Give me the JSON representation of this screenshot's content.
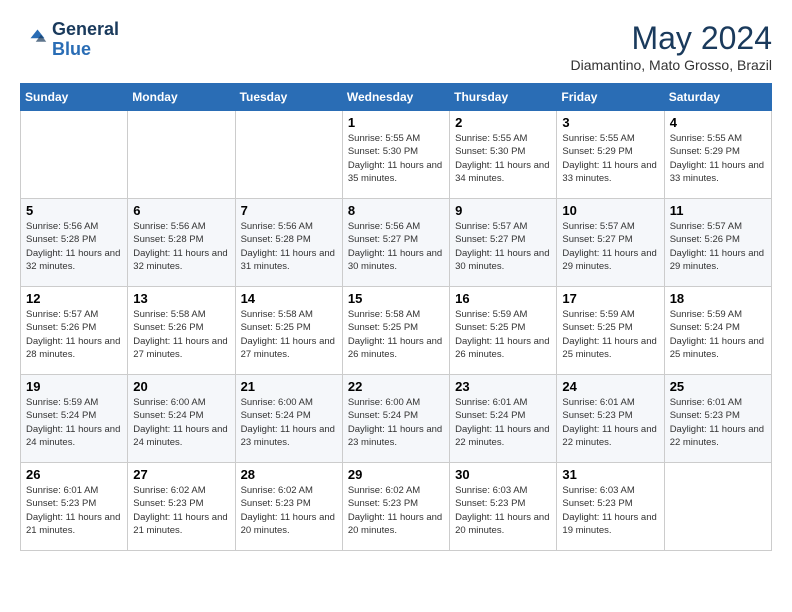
{
  "header": {
    "logo_general": "General",
    "logo_blue": "Blue",
    "month_year": "May 2024",
    "location": "Diamantino, Mato Grosso, Brazil"
  },
  "days_of_week": [
    "Sunday",
    "Monday",
    "Tuesday",
    "Wednesday",
    "Thursday",
    "Friday",
    "Saturday"
  ],
  "weeks": [
    [
      {
        "day": "",
        "info": ""
      },
      {
        "day": "",
        "info": ""
      },
      {
        "day": "",
        "info": ""
      },
      {
        "day": "1",
        "info": "Sunrise: 5:55 AM\nSunset: 5:30 PM\nDaylight: 11 hours\nand 35 minutes."
      },
      {
        "day": "2",
        "info": "Sunrise: 5:55 AM\nSunset: 5:30 PM\nDaylight: 11 hours\nand 34 minutes."
      },
      {
        "day": "3",
        "info": "Sunrise: 5:55 AM\nSunset: 5:29 PM\nDaylight: 11 hours\nand 33 minutes."
      },
      {
        "day": "4",
        "info": "Sunrise: 5:55 AM\nSunset: 5:29 PM\nDaylight: 11 hours\nand 33 minutes."
      }
    ],
    [
      {
        "day": "5",
        "info": "Sunrise: 5:56 AM\nSunset: 5:28 PM\nDaylight: 11 hours\nand 32 minutes."
      },
      {
        "day": "6",
        "info": "Sunrise: 5:56 AM\nSunset: 5:28 PM\nDaylight: 11 hours\nand 32 minutes."
      },
      {
        "day": "7",
        "info": "Sunrise: 5:56 AM\nSunset: 5:28 PM\nDaylight: 11 hours\nand 31 minutes."
      },
      {
        "day": "8",
        "info": "Sunrise: 5:56 AM\nSunset: 5:27 PM\nDaylight: 11 hours\nand 30 minutes."
      },
      {
        "day": "9",
        "info": "Sunrise: 5:57 AM\nSunset: 5:27 PM\nDaylight: 11 hours\nand 30 minutes."
      },
      {
        "day": "10",
        "info": "Sunrise: 5:57 AM\nSunset: 5:27 PM\nDaylight: 11 hours\nand 29 minutes."
      },
      {
        "day": "11",
        "info": "Sunrise: 5:57 AM\nSunset: 5:26 PM\nDaylight: 11 hours\nand 29 minutes."
      }
    ],
    [
      {
        "day": "12",
        "info": "Sunrise: 5:57 AM\nSunset: 5:26 PM\nDaylight: 11 hours\nand 28 minutes."
      },
      {
        "day": "13",
        "info": "Sunrise: 5:58 AM\nSunset: 5:26 PM\nDaylight: 11 hours\nand 27 minutes."
      },
      {
        "day": "14",
        "info": "Sunrise: 5:58 AM\nSunset: 5:25 PM\nDaylight: 11 hours\nand 27 minutes."
      },
      {
        "day": "15",
        "info": "Sunrise: 5:58 AM\nSunset: 5:25 PM\nDaylight: 11 hours\nand 26 minutes."
      },
      {
        "day": "16",
        "info": "Sunrise: 5:59 AM\nSunset: 5:25 PM\nDaylight: 11 hours\nand 26 minutes."
      },
      {
        "day": "17",
        "info": "Sunrise: 5:59 AM\nSunset: 5:25 PM\nDaylight: 11 hours\nand 25 minutes."
      },
      {
        "day": "18",
        "info": "Sunrise: 5:59 AM\nSunset: 5:24 PM\nDaylight: 11 hours\nand 25 minutes."
      }
    ],
    [
      {
        "day": "19",
        "info": "Sunrise: 5:59 AM\nSunset: 5:24 PM\nDaylight: 11 hours\nand 24 minutes."
      },
      {
        "day": "20",
        "info": "Sunrise: 6:00 AM\nSunset: 5:24 PM\nDaylight: 11 hours\nand 24 minutes."
      },
      {
        "day": "21",
        "info": "Sunrise: 6:00 AM\nSunset: 5:24 PM\nDaylight: 11 hours\nand 23 minutes."
      },
      {
        "day": "22",
        "info": "Sunrise: 6:00 AM\nSunset: 5:24 PM\nDaylight: 11 hours\nand 23 minutes."
      },
      {
        "day": "23",
        "info": "Sunrise: 6:01 AM\nSunset: 5:24 PM\nDaylight: 11 hours\nand 22 minutes."
      },
      {
        "day": "24",
        "info": "Sunrise: 6:01 AM\nSunset: 5:23 PM\nDaylight: 11 hours\nand 22 minutes."
      },
      {
        "day": "25",
        "info": "Sunrise: 6:01 AM\nSunset: 5:23 PM\nDaylight: 11 hours\nand 22 minutes."
      }
    ],
    [
      {
        "day": "26",
        "info": "Sunrise: 6:01 AM\nSunset: 5:23 PM\nDaylight: 11 hours\nand 21 minutes."
      },
      {
        "day": "27",
        "info": "Sunrise: 6:02 AM\nSunset: 5:23 PM\nDaylight: 11 hours\nand 21 minutes."
      },
      {
        "day": "28",
        "info": "Sunrise: 6:02 AM\nSunset: 5:23 PM\nDaylight: 11 hours\nand 20 minutes."
      },
      {
        "day": "29",
        "info": "Sunrise: 6:02 AM\nSunset: 5:23 PM\nDaylight: 11 hours\nand 20 minutes."
      },
      {
        "day": "30",
        "info": "Sunrise: 6:03 AM\nSunset: 5:23 PM\nDaylight: 11 hours\nand 20 minutes."
      },
      {
        "day": "31",
        "info": "Sunrise: 6:03 AM\nSunset: 5:23 PM\nDaylight: 11 hours\nand 19 minutes."
      },
      {
        "day": "",
        "info": ""
      }
    ]
  ]
}
